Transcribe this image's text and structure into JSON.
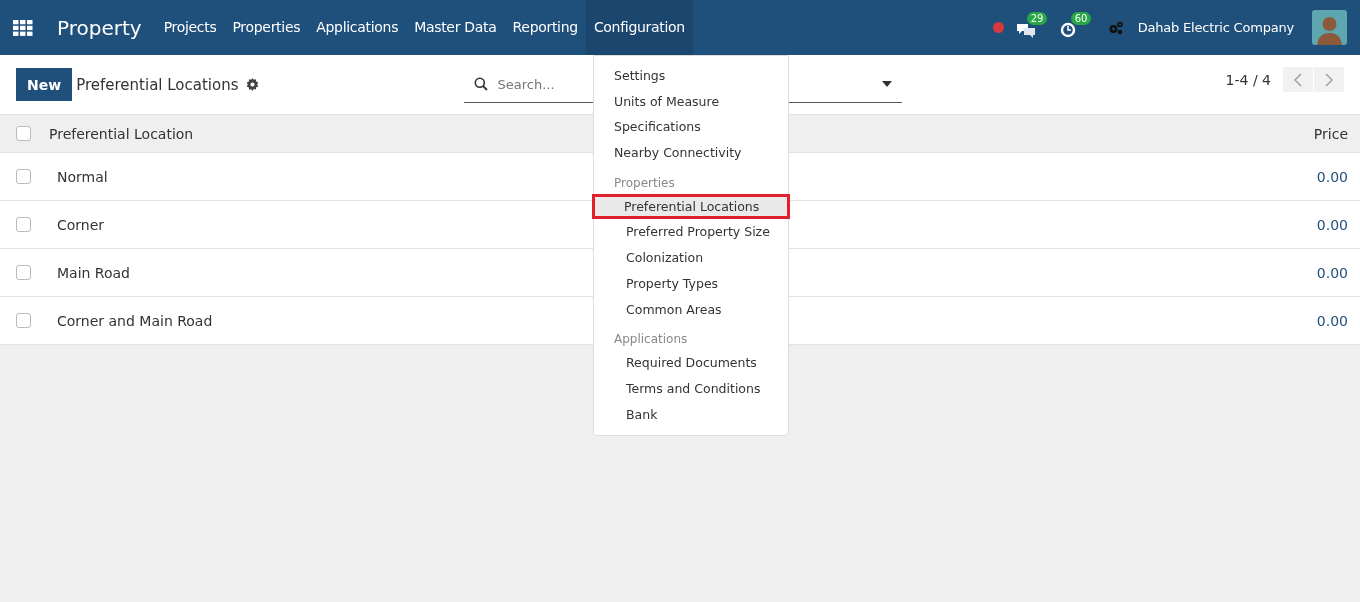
{
  "navbar": {
    "app_name": "Property",
    "menus": [
      {
        "label": "Projects",
        "open": false
      },
      {
        "label": "Properties",
        "open": false
      },
      {
        "label": "Applications",
        "open": false
      },
      {
        "label": "Master Data",
        "open": false
      },
      {
        "label": "Reporting",
        "open": false
      },
      {
        "label": "Configuration",
        "open": true
      }
    ],
    "messages_count": "29",
    "activities_count": "60",
    "company": "Dahab Electric Company"
  },
  "control_panel": {
    "new_button": "New",
    "title": "Preferential Locations",
    "search": {
      "placeholder": "Search..."
    },
    "pager": "1-4 / 4"
  },
  "table": {
    "columns": [
      "Preferential Location",
      "Price"
    ],
    "all_checked": false,
    "rows": [
      {
        "name": "Normal",
        "price": "0.00",
        "checked": false
      },
      {
        "name": "Corner",
        "price": "0.00",
        "checked": false
      },
      {
        "name": "Main Road",
        "price": "0.00",
        "checked": false
      },
      {
        "name": "Corner and Main Road",
        "price": "0.00",
        "checked": false
      }
    ]
  },
  "dropdown": [
    {
      "kind": "item",
      "label": "Settings",
      "selected": false
    },
    {
      "kind": "item",
      "label": "Units of Measure",
      "selected": false
    },
    {
      "kind": "item",
      "label": "Specifications",
      "selected": false
    },
    {
      "kind": "item",
      "label": "Nearby Connectivity",
      "selected": false
    },
    {
      "kind": "header",
      "label": "Properties"
    },
    {
      "kind": "subitem",
      "label": "Preferential Locations",
      "selected": true
    },
    {
      "kind": "subitem",
      "label": "Preferred Property Size",
      "selected": false
    },
    {
      "kind": "subitem",
      "label": "Colonization",
      "selected": false
    },
    {
      "kind": "subitem",
      "label": "Property Types",
      "selected": false
    },
    {
      "kind": "subitem",
      "label": "Common Areas",
      "selected": false
    },
    {
      "kind": "header",
      "label": "Applications"
    },
    {
      "kind": "subitem",
      "label": "Required Documents",
      "selected": false
    },
    {
      "kind": "subitem",
      "label": "Terms and Conditions",
      "selected": false
    },
    {
      "kind": "subitem",
      "label": "Bank",
      "selected": false
    }
  ]
}
